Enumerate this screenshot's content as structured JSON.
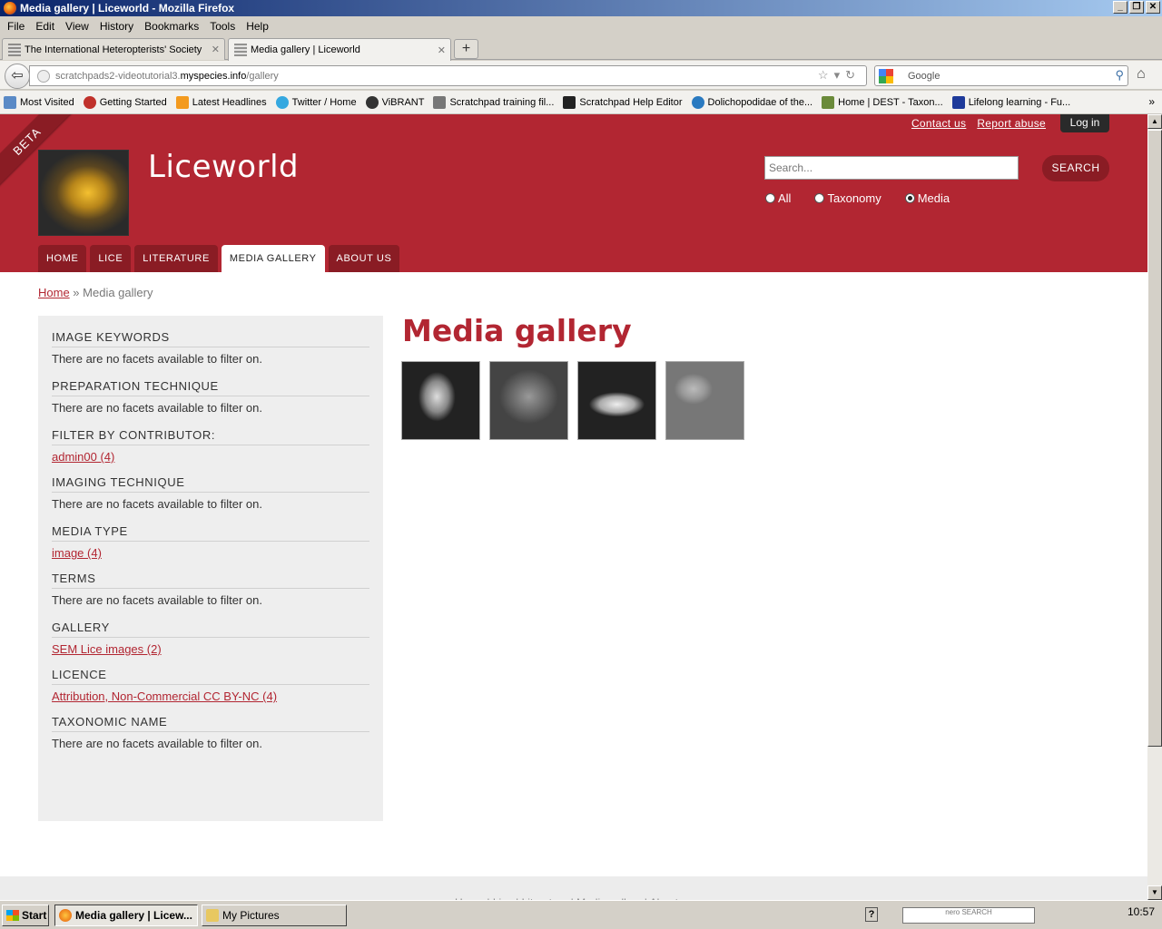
{
  "window": {
    "title": "Media gallery | Liceworld - Mozilla Firefox"
  },
  "menu": [
    "File",
    "Edit",
    "View",
    "History",
    "Bookmarks",
    "Tools",
    "Help"
  ],
  "tabs": [
    {
      "label": "The International Heteropterists' Society"
    },
    {
      "label": "Media gallery | Liceworld"
    }
  ],
  "nav": {
    "url_prefix": "scratchpads2-videotutorial3.",
    "url_domain": "myspecies.info",
    "url_path": "/gallery",
    "search_placeholder": "Google"
  },
  "bookmarks": [
    "Most Visited",
    "Getting Started",
    "Latest Headlines",
    "Twitter / Home",
    "ViBRANT",
    "Scratchpad training fil...",
    "Scratchpad Help Editor",
    "Dolichopodidae of the...",
    "Home | DEST - Taxon...",
    "Lifelong learning - Fu..."
  ],
  "site": {
    "beta": "BETA",
    "name": "Liceworld",
    "contact": "Contact us",
    "report": "Report abuse",
    "login": "Log in",
    "search_placeholder": "Search...",
    "search_button": "SEARCH",
    "radio_all": "All",
    "radio_taxonomy": "Taxonomy",
    "radio_media": "Media",
    "selected_radio": "Media"
  },
  "mainnav": [
    "HOME",
    "LICE",
    "LITERATURE",
    "MEDIA GALLERY",
    "ABOUT US"
  ],
  "breadcrumb": {
    "home": "Home",
    "sep": " » ",
    "current": "Media gallery"
  },
  "page_title": "Media gallery",
  "facets": [
    {
      "title": "IMAGE KEYWORDS",
      "text": "There are no facets available to filter on."
    },
    {
      "title": "PREPARATION TECHNIQUE",
      "text": "There are no facets available to filter on."
    },
    {
      "title": "FILTER BY CONTRIBUTOR:",
      "link": "admin00 (4)"
    },
    {
      "title": "IMAGING TECHNIQUE",
      "text": "There are no facets available to filter on."
    },
    {
      "title": "MEDIA TYPE",
      "link": "image (4)"
    },
    {
      "title": "TERMS",
      "text": "There are no facets available to filter on."
    },
    {
      "title": "GALLERY",
      "link": "SEM Lice images (2)"
    },
    {
      "title": "LICENCE",
      "link": "Attribution, Non-Commercial CC BY-NC (4)"
    },
    {
      "title": "TAXONOMIC NAME",
      "text": "There are no facets available to filter on."
    }
  ],
  "gallery_count": 4,
  "footer_text": "Home | Lice | Literature | Media gallery | About us",
  "taskbar": {
    "start": "Start",
    "items": [
      "Media gallery | Licew...",
      "My Pictures"
    ],
    "nero": "nero SEARCH",
    "time": "10:57"
  },
  "colors": {
    "brand": "#b22632",
    "brand_dark": "#8a1c24"
  }
}
